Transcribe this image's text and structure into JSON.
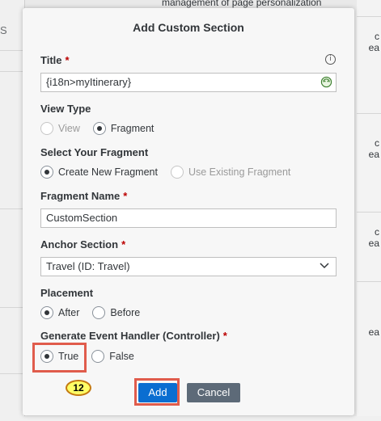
{
  "background": {
    "left_stub": "S",
    "top_text": "management of page personalization",
    "right_fragments": [
      "c",
      "ea",
      "c",
      "ea",
      "c",
      "ea",
      "ea"
    ]
  },
  "dialog": {
    "title": "Add Custom Section",
    "fields": {
      "title": {
        "label": "Title",
        "required": "*",
        "value": "{i18n>myItinerary}",
        "info_icon": "info-icon",
        "value_help_icon": "i18n-icon"
      },
      "view_type": {
        "label": "View Type",
        "options": [
          "View",
          "Fragment"
        ],
        "selected": "Fragment",
        "disabled": [
          "View"
        ]
      },
      "select_fragment": {
        "label": "Select Your Fragment",
        "options": [
          "Create New Fragment",
          "Use Existing Fragment"
        ],
        "selected": "Create New Fragment",
        "disabled": [
          "Use Existing Fragment"
        ]
      },
      "fragment_name": {
        "label": "Fragment Name",
        "required": "*",
        "value": "CustomSection"
      },
      "anchor_section": {
        "label": "Anchor Section",
        "required": "*",
        "value": "Travel (ID: Travel)",
        "icon": "chevron-down-icon"
      },
      "placement": {
        "label": "Placement",
        "options": [
          "After",
          "Before"
        ],
        "selected": "After"
      },
      "event_handler": {
        "label": "Generate Event Handler (Controller)",
        "required": "*",
        "options": [
          "True",
          "False"
        ],
        "selected": "True"
      }
    },
    "buttons": {
      "add": "Add",
      "cancel": "Cancel"
    },
    "callout_number": "12"
  },
  "colors": {
    "accent": "#0a6ed1",
    "cancel": "#5d6a78",
    "highlight": "#e05c4c",
    "required": "#bb0000",
    "callout_fill": "#ffff66"
  }
}
